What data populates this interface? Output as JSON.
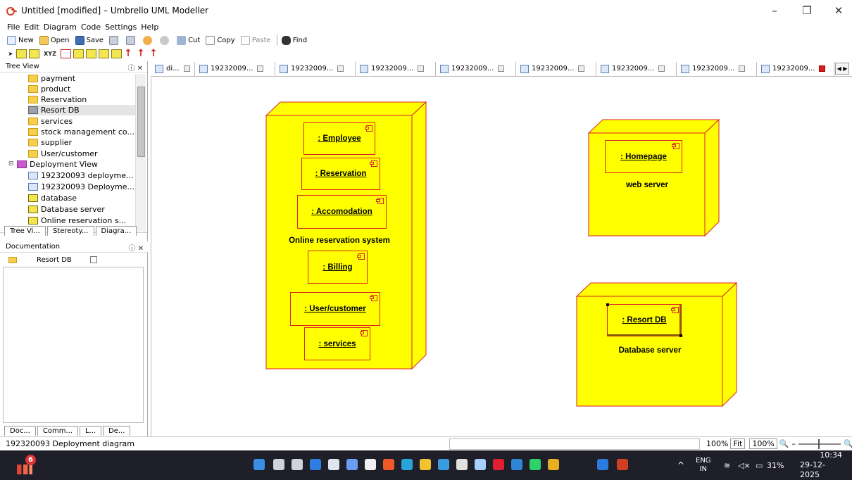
{
  "window": {
    "title": "Untitled [modified] – Umbrello UML Modeller",
    "min_glyph": "–",
    "max_glyph": "❐",
    "close_glyph": "✕"
  },
  "menu": [
    "File",
    "Edit",
    "Diagram",
    "Code",
    "Settings",
    "Help"
  ],
  "toolbar": {
    "new": "New",
    "open": "Open",
    "save": "Save",
    "cut": "Cut",
    "copy": "Copy",
    "paste": "Paste",
    "find": "Find",
    "xyz": "XYZ"
  },
  "tree_view": {
    "title": "Tree View",
    "controls": "ⓘ ✕",
    "items": [
      {
        "label": "payment",
        "type": "component"
      },
      {
        "label": "product",
        "type": "component"
      },
      {
        "label": "Reservation",
        "type": "component"
      },
      {
        "label": "Resort DB",
        "type": "artifact",
        "selected": true
      },
      {
        "label": "services",
        "type": "component"
      },
      {
        "label": "stock management co...",
        "type": "component"
      },
      {
        "label": "supplier",
        "type": "component"
      },
      {
        "label": "User/customer",
        "type": "component"
      },
      {
        "label": "Deployment View",
        "type": "folder"
      },
      {
        "label": "192320093 deployme...",
        "type": "diagram"
      },
      {
        "label": "192320093 Deployme...",
        "type": "diagram"
      },
      {
        "label": "database",
        "type": "node"
      },
      {
        "label": "Database server",
        "type": "node"
      },
      {
        "label": "Online reservation s...",
        "type": "node"
      }
    ],
    "tabs": [
      "Tree Vi...",
      "Stereoty...",
      "Diagra..."
    ]
  },
  "documentation": {
    "title": "Documentation",
    "controls": "ⓘ ✕",
    "item_label": "Resort DB",
    "tabs": [
      "Doc...",
      "Comm...",
      "L...",
      "De..."
    ]
  },
  "diagram_tabs": [
    {
      "label": "di...",
      "active": false
    },
    {
      "label": "19232009...",
      "active": false
    },
    {
      "label": "19232009...",
      "active": false
    },
    {
      "label": "19232009...",
      "active": false
    },
    {
      "label": "19232009...",
      "active": false
    },
    {
      "label": "19232009...",
      "active": false
    },
    {
      "label": "19232009...",
      "active": false
    },
    {
      "label": "19232009...",
      "active": false
    },
    {
      "label": "19232009...",
      "active": true
    }
  ],
  "diagram": {
    "nodes": [
      {
        "label": "Online reservation system",
        "components": [
          ": Employee",
          ": Reservation",
          ": Accomodation",
          ": Billing",
          ": User/customer",
          ": services"
        ]
      },
      {
        "label": "web server",
        "components": [
          ": Homepage"
        ]
      },
      {
        "label": "Database server",
        "components": [
          ": Resort DB"
        ]
      }
    ]
  },
  "status": {
    "message": "192320093 Deployment diagram",
    "zoom_left": "100%",
    "fit": "Fit",
    "zoom_right": "100%"
  },
  "taskbar": {
    "weather_badge": "6",
    "lang_top": "ENG",
    "lang_bottom": "IN",
    "battery": "31%",
    "time": "10:34",
    "date": "29-12-2025"
  },
  "colors": {
    "node_fill": "#ffff00",
    "node_border": "#dd2222",
    "taskbar": "#1f1f2a"
  }
}
